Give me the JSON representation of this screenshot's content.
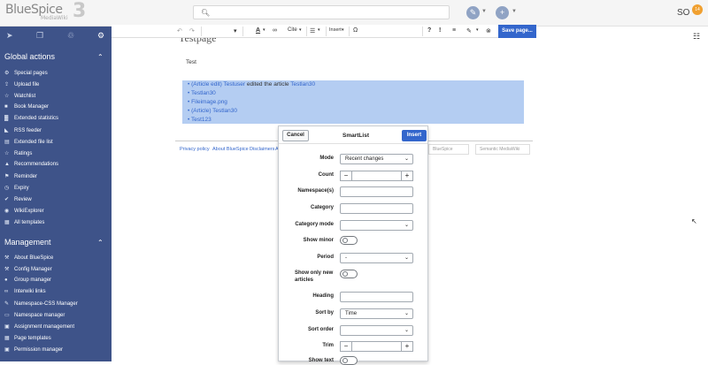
{
  "app": {
    "logo_text": "BlueSpice",
    "logo_sub": "MediaWiki",
    "logo_num": "3",
    "user_initials": "SO",
    "notification_count": "14"
  },
  "sidebar": {
    "tab_icons": [
      "navigation-icon",
      "pages-icon",
      "trash-icon",
      "gear-icon"
    ],
    "sections": [
      {
        "title": "Global actions",
        "items": [
          {
            "label": "Special pages",
            "icon": "special-icon"
          },
          {
            "label": "Upload file",
            "icon": "upload-icon"
          },
          {
            "label": "Watchlist",
            "icon": "star-icon"
          },
          {
            "label": "Book Manager",
            "icon": "book-icon"
          },
          {
            "label": "Extended statistics",
            "icon": "chart-icon"
          },
          {
            "label": "RSS feeder",
            "icon": "rss-icon"
          },
          {
            "label": "Extended file list",
            "icon": "file-icon"
          },
          {
            "label": "Ratings",
            "icon": "star-icon"
          },
          {
            "label": "Recommendations",
            "icon": "thumb-icon"
          },
          {
            "label": "Reminder",
            "icon": "flag-icon"
          },
          {
            "label": "Expiry",
            "icon": "clock-icon"
          },
          {
            "label": "Review",
            "icon": "check-icon"
          },
          {
            "label": "WikiExplorer",
            "icon": "eye-icon"
          },
          {
            "label": "All templates",
            "icon": "template-icon"
          }
        ]
      },
      {
        "title": "Management",
        "items": [
          {
            "label": "About BlueSpice",
            "icon": "wrench-icon"
          },
          {
            "label": "Config Manager",
            "icon": "wrench-icon"
          },
          {
            "label": "Group manager",
            "icon": "group-icon"
          },
          {
            "label": "Interwiki links",
            "icon": "link-icon"
          },
          {
            "label": "Namespace-CSS Manager",
            "icon": "brush-icon"
          },
          {
            "label": "Namespace manager",
            "icon": "namespace-icon"
          },
          {
            "label": "Assignment management",
            "icon": "assign-icon"
          },
          {
            "label": "Page templates",
            "icon": "template-icon"
          },
          {
            "label": "Permission manager",
            "icon": "lock-icon"
          }
        ]
      }
    ]
  },
  "toolbar": {
    "cite_label": "Cite",
    "insert_label": "Insert",
    "save_label": "Save page..."
  },
  "content": {
    "title": "Testpage",
    "paragraph": "Test",
    "list": [
      {
        "link1": "(Article edit) Testuser",
        "plain": " edited the article ",
        "link2": "Testlan30"
      },
      {
        "link1": "Testlan30",
        "plain": "",
        "link2": ""
      },
      {
        "link1": "Fileimage.png",
        "plain": "",
        "link2": ""
      },
      {
        "link1": "(Article) Testlan30",
        "plain": "",
        "link2": ""
      },
      {
        "link1": "Test123",
        "plain": "",
        "link2": ""
      }
    ],
    "footer_links": [
      "Privacy policy",
      "About BlueSpice",
      "Disclaimers",
      "A"
    ],
    "footer_badges": [
      "BlueSpice",
      "Semantic MediaWiki"
    ]
  },
  "dialog": {
    "title": "SmartList",
    "cancel": "Cancel",
    "insert": "Insert",
    "fields": [
      {
        "label": "Mode",
        "type": "select",
        "value": "Recent changes"
      },
      {
        "label": "Count",
        "type": "stepper",
        "value": ""
      },
      {
        "label": "Namespace(s)",
        "type": "text",
        "value": ""
      },
      {
        "label": "Category",
        "type": "text",
        "value": ""
      },
      {
        "label": "Category mode",
        "type": "select",
        "value": ""
      },
      {
        "label": "Show minor",
        "type": "toggle",
        "value": "off"
      },
      {
        "label": "Period",
        "type": "select",
        "value": "-"
      },
      {
        "label": "Show only new articles",
        "type": "toggle",
        "value": "off"
      },
      {
        "label": "Heading",
        "type": "text",
        "value": ""
      },
      {
        "label": "Sort by",
        "type": "select",
        "value": "Time"
      },
      {
        "label": "Sort order",
        "type": "select",
        "value": ""
      },
      {
        "label": "Trim",
        "type": "stepper",
        "value": ""
      },
      {
        "label": "Show text",
        "type": "toggle",
        "value": "off"
      }
    ]
  },
  "colors": {
    "sidebar_bg": "#3e5389",
    "accent": "#3366cc",
    "selection": "#b4cdf2"
  }
}
